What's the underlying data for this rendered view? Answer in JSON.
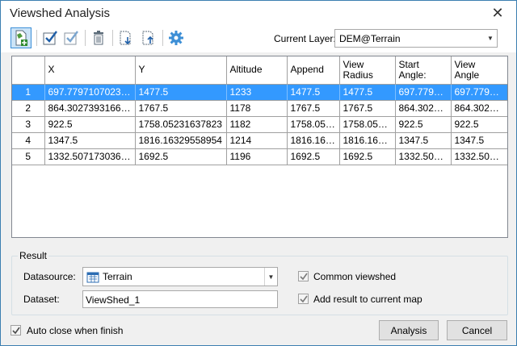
{
  "window": {
    "title": "Viewshed Analysis",
    "close_icon": "close-icon"
  },
  "toolbar": {
    "current_layer_label": "Current Layer:",
    "current_layer_value": "DEM@Terrain"
  },
  "table": {
    "columns": [
      "",
      "X",
      "Y",
      "Altitude",
      "Append",
      "View\nRadius",
      "Start\nAngle:",
      "View\nAngle"
    ],
    "rows": [
      [
        "1",
        "697.779710702354",
        "1477.5",
        "1233",
        "1477.5",
        "1477.5",
        "697.77971...",
        "697.77971..."
      ],
      [
        "2",
        "864.302739316682",
        "1767.5",
        "1178",
        "1767.5",
        "1767.5",
        "864.30273...",
        "864.30273..."
      ],
      [
        "3",
        "922.5",
        "1758.05231637823",
        "1182",
        "1758.052...",
        "1758.0523...",
        "922.5",
        "922.5"
      ],
      [
        "4",
        "1347.5",
        "1816.16329558954",
        "1214",
        "1816.163...",
        "1816.163...",
        "1347.5",
        "1347.5"
      ],
      [
        "5",
        "1332.50717303693",
        "1692.5",
        "1196",
        "1692.5",
        "1692.5",
        "1332.5071...",
        "1332.5071..."
      ]
    ],
    "selected_row": 0
  },
  "result": {
    "legend": "Result",
    "datasource_label": "Datasource:",
    "datasource_value": "Terrain",
    "dataset_label": "Dataset:",
    "dataset_value": "ViewShed_1",
    "common_viewshed_label": "Common viewshed",
    "add_result_label": "Add result to current map"
  },
  "footer": {
    "auto_close_label": "Auto close when finish",
    "analysis_button": "Analysis",
    "cancel_button": "Cancel"
  },
  "colors": {
    "selection": "#3399ff",
    "accent": "#3c8fd8"
  }
}
